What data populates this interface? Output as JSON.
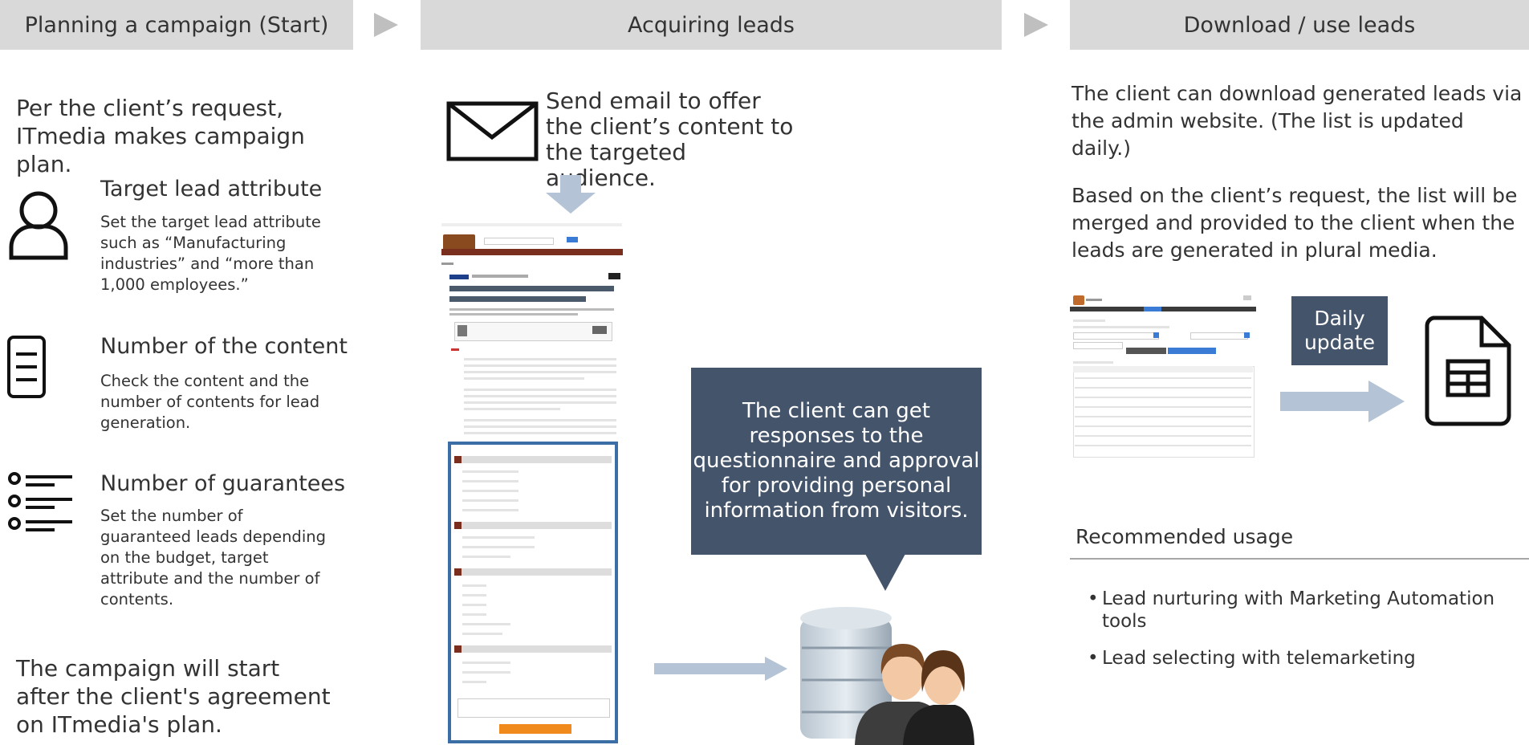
{
  "phases": {
    "start": "Planning a campaign (Start)",
    "acquire": "Acquiring leads",
    "download": "Download / use leads"
  },
  "planning": {
    "intro": "Per the client’s request, ITmedia makes campaign plan.",
    "items": [
      {
        "icon": "person-outline-icon",
        "title": "Target lead attribute",
        "desc": "Set the target lead attribute such as “Manufacturing industries” and “more than 1,000 employees.”"
      },
      {
        "icon": "document-list-icon",
        "title": "Number of the content",
        "desc": "Check the content and the number of contents for lead generation."
      },
      {
        "icon": "bulleted-list-icon",
        "title": "Number of guarantees",
        "desc": "Set the number of guaranteed leads depending on the budget, target attribute and the number of contents."
      }
    ],
    "outro": "The campaign will start after the client's agreement on ITmedia's plan."
  },
  "acquiring": {
    "email_text": "Send email to offer the client’s content to the targeted audience.",
    "callout": "The client can get responses to the questionnaire and approval for providing personal information from visitors."
  },
  "download": {
    "para1": "The client can download generated leads via the admin website. (The list is updated daily.)",
    "para2": "Based on the client’s request, the list will be merged and provided to the client when the leads are generated in plural media.",
    "daily": "Daily update",
    "rec_heading": "Recommended usage",
    "bullets": [
      "Lead nurturing with Marketing Automation tools",
      "Lead selecting with telemarketing"
    ]
  },
  "colors": {
    "header_bg": "#d9d9d9",
    "callout_bg": "#44546a",
    "arrow": "#b4c3d6",
    "form_border": "#3a6ea5"
  }
}
